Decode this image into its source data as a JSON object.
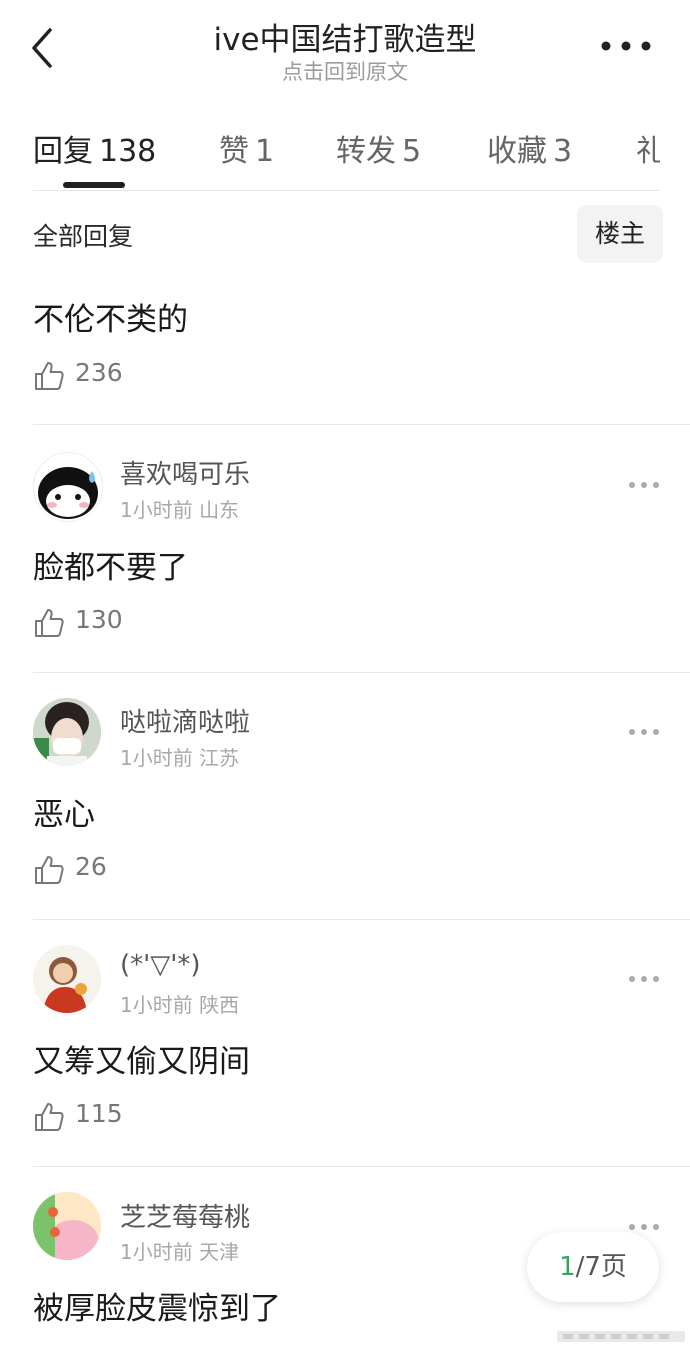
{
  "header": {
    "title": "ive中国结打歌造型",
    "subtitle": "点击回到原文"
  },
  "tabs": [
    {
      "label": "回复",
      "count": "138",
      "active": true
    },
    {
      "label": "赞",
      "count": "1",
      "active": false
    },
    {
      "label": "转发",
      "count": "5",
      "active": false
    },
    {
      "label": "收藏",
      "count": "3",
      "active": false
    },
    {
      "label": "礼",
      "count": "",
      "active": false
    }
  ],
  "filter": {
    "label": "全部回复",
    "op_button": "楼主"
  },
  "comments": [
    {
      "text": "不伦不类的",
      "likes": "236"
    },
    {
      "username": "喜欢喝可乐",
      "time": "1小时前",
      "location": "山东",
      "text": "脸都不要了",
      "likes": "130",
      "avatar": "penguin-avatar"
    },
    {
      "username": "哒啦滴哒啦",
      "time": "1小时前",
      "location": "江苏",
      "text": "恶心",
      "likes": "26",
      "avatar": "masked-person-avatar"
    },
    {
      "username": "(*'▽'*)",
      "time": "1小时前",
      "location": "陕西",
      "text": "又筹又偷又阴间",
      "likes": "115",
      "avatar": "cartoon-character-avatar"
    },
    {
      "username": "芝芝莓莓桃",
      "time": "1小时前",
      "location": "天津",
      "text": "被厚脸皮震惊到了",
      "avatar": "pink-cartoon-avatar"
    }
  ],
  "pager": {
    "current": "1",
    "total": "/7页"
  },
  "colors": {
    "accent_green": "#3aa55a",
    "text_primary": "#1a1a1a",
    "text_secondary": "#a8a8a8"
  }
}
